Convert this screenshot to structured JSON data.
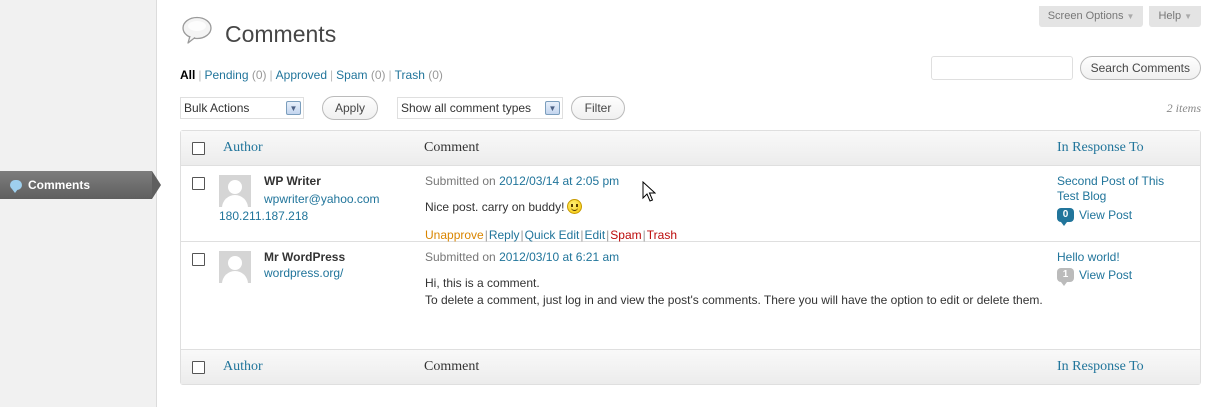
{
  "admin_menu": {
    "active_item": "Comments",
    "active_icon": "comment-bubble-icon"
  },
  "screen_meta": {
    "screen_options": "Screen Options",
    "help": "Help",
    "dropdown_glyph": "▼"
  },
  "header": {
    "title": "Comments",
    "icon": "comments-icon"
  },
  "filters": {
    "all": "All",
    "pending": "Pending",
    "pending_count": "(0)",
    "approved": "Approved",
    "spam": "Spam",
    "spam_count": "(0)",
    "trash": "Trash",
    "trash_count": "(0)",
    "separator": "|"
  },
  "search": {
    "value": "",
    "button": "Search Comments"
  },
  "tablenav": {
    "bulk_actions": "Bulk Actions",
    "apply": "Apply",
    "comment_type": "Show all comment types",
    "filter": "Filter",
    "items_count": "2 items"
  },
  "table": {
    "columns": {
      "author": "Author",
      "comment": "Comment",
      "in_response_to": "In Response To"
    },
    "rows": [
      {
        "author_name": "WP Writer",
        "author_url": "wpwriter@yahoo.com",
        "author_ip": "180.211.187.218",
        "submitted_prefix": "Submitted on",
        "submitted_date": "2012/03/14 at 2:05 pm",
        "comment_text": "Nice post. carry on buddy!",
        "actions": {
          "unapprove": "Unapprove",
          "reply": "Reply",
          "quick_edit": "Quick Edit",
          "edit": "Edit",
          "spam": "Spam",
          "trash": "Trash"
        },
        "response_title": "Second Post of This Test Blog",
        "comment_count": "0",
        "view_post": "View Post"
      },
      {
        "author_name": "Mr WordPress",
        "author_url": "wordpress.org/",
        "submitted_prefix": "Submitted on",
        "submitted_date": "2012/03/10 at 6:21 am",
        "comment_line1": "Hi, this is a comment.",
        "comment_line2": "To delete a comment, just log in and view the post's comments. There you will have the option to edit or delete them.",
        "response_title": "Hello world!",
        "comment_count": "1",
        "view_post": "View Post"
      }
    ]
  },
  "colors": {
    "link": "#21759b",
    "unapprove": "#d98500",
    "spam_trash": "#bc0b0b",
    "menu_active": "#6d6d6d"
  }
}
